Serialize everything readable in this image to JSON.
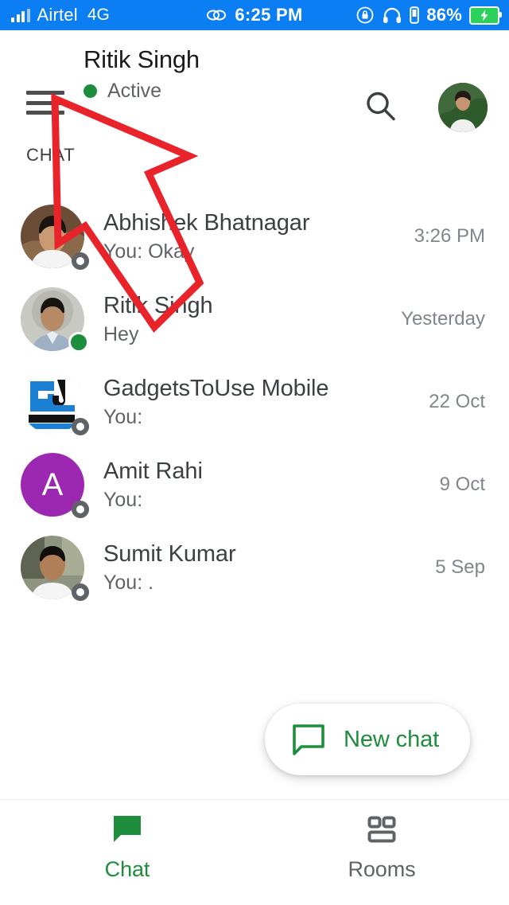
{
  "status_bar": {
    "carrier": "Airtel",
    "network": "4G",
    "time": "6:25 PM",
    "battery_percent": "86%",
    "icons": {
      "signal": "signal-bars-icon",
      "link": "link-icon",
      "rotation_lock": "rotation-lock-icon",
      "headphones": "headphones-icon",
      "vibrate": "vibrate-icon",
      "battery": "battery-charging-icon"
    },
    "background_color": "#0b7ef4",
    "text_color": "#ffffff"
  },
  "header": {
    "menu_icon": "hamburger-menu-icon",
    "title": "Ritik Singh",
    "presence_status": "Active",
    "presence_color": "#1e8e3e",
    "search_icon": "search-icon",
    "profile_avatar": "user-avatar"
  },
  "list": {
    "section_label": "CHAT",
    "items": [
      {
        "name": "Abhishek Bhatnagar",
        "preview": "You: Okay",
        "time": "3:26 PM",
        "presence": "offline",
        "avatar_type": "photo"
      },
      {
        "name": "Ritik Singh",
        "preview": "Hey",
        "time": "Yesterday",
        "presence": "online",
        "avatar_type": "photo"
      },
      {
        "name": "GadgetsToUse Mobile",
        "preview": "You:",
        "time": "22 Oct",
        "presence": "offline",
        "avatar_type": "logo"
      },
      {
        "name": "Amit Rahi",
        "preview": "You:",
        "time": "9 Oct",
        "presence": "offline",
        "avatar_type": "initial",
        "initial": "A",
        "avatar_color": "#9c27b0"
      },
      {
        "name": "Sumit Kumar",
        "preview": "You: .",
        "time": "5 Sep",
        "presence": "offline",
        "avatar_type": "photo"
      }
    ]
  },
  "fab": {
    "label": "New chat",
    "icon": "chat-bubble-outline-icon",
    "color": "#1e8e3e"
  },
  "bottom_nav": {
    "items": [
      {
        "label": "Chat",
        "icon": "chat-bubble-filled-icon",
        "active": true,
        "color": "#1e8e3e"
      },
      {
        "label": "Rooms",
        "icon": "rooms-grid-icon",
        "active": false,
        "color": "#5f6368"
      }
    ]
  },
  "annotation": {
    "type": "arrow",
    "color": "#e8242a",
    "points_to": "first-chat-avatar"
  }
}
